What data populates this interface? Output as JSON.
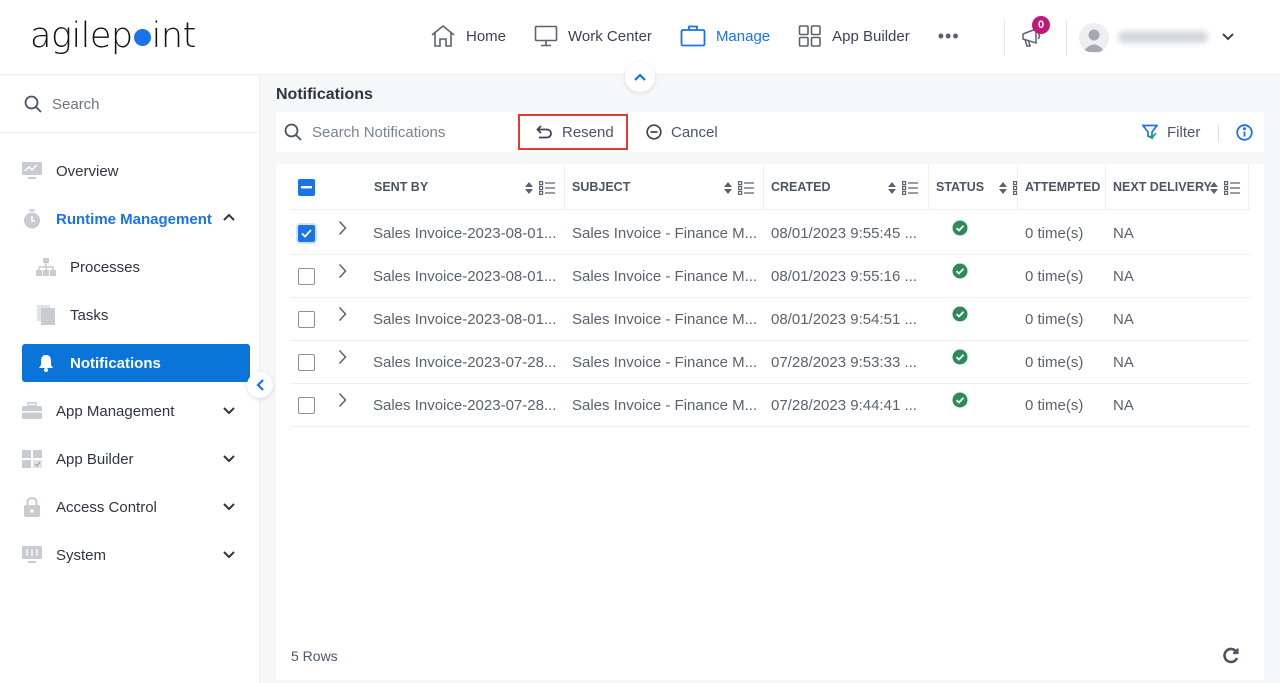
{
  "brand": {
    "logo_left": "agilep",
    "logo_right": "int",
    "accent": "#1a73e8"
  },
  "topnav": {
    "items": [
      {
        "label": "Home",
        "icon": "home-icon",
        "active": false
      },
      {
        "label": "Work Center",
        "icon": "monitor-icon",
        "active": false
      },
      {
        "label": "Manage",
        "icon": "briefcase-icon",
        "active": true
      },
      {
        "label": "App Builder",
        "icon": "grid-icon",
        "active": false
      }
    ],
    "more_label": "•••",
    "notification_count": "0"
  },
  "sidebar": {
    "search_placeholder": "Search",
    "items": [
      {
        "label": "Overview",
        "icon": "chart-monitor-icon"
      },
      {
        "label": "Runtime Management",
        "icon": "stopwatch-icon",
        "expanded": true
      },
      {
        "label": "Processes",
        "icon": "hierarchy-icon"
      },
      {
        "label": "Tasks",
        "icon": "tasks-icon"
      },
      {
        "label": "Notifications",
        "icon": "bell-icon",
        "active": true
      },
      {
        "label": "App Management",
        "icon": "toolbox-icon"
      },
      {
        "label": "App Builder",
        "icon": "app-builder-icon"
      },
      {
        "label": "Access Control",
        "icon": "lock-icon"
      },
      {
        "label": "System",
        "icon": "system-icon"
      }
    ]
  },
  "main": {
    "title": "Notifications",
    "toolbar": {
      "search_placeholder": "Search Notifications",
      "resend_label": "Resend",
      "cancel_label": "Cancel",
      "filter_label": "Filter"
    },
    "columns": [
      "SENT BY",
      "SUBJECT",
      "CREATED",
      "STATUS",
      "ATTEMPTED",
      "NEXT DELIVERY"
    ],
    "rows": [
      {
        "checked": true,
        "sent_by": "Sales Invoice-2023-08-01...",
        "subject": "Sales Invoice - Finance M...",
        "created": "08/01/2023 9:55:45 ...",
        "status": "success",
        "attempted": "0 time(s)",
        "next_delivery": "NA"
      },
      {
        "checked": false,
        "sent_by": "Sales Invoice-2023-08-01...",
        "subject": "Sales Invoice - Finance M...",
        "created": "08/01/2023 9:55:16 ...",
        "status": "success",
        "attempted": "0 time(s)",
        "next_delivery": "NA"
      },
      {
        "checked": false,
        "sent_by": "Sales Invoice-2023-08-01...",
        "subject": "Sales Invoice - Finance M...",
        "created": "08/01/2023 9:54:51 ...",
        "status": "success",
        "attempted": "0 time(s)",
        "next_delivery": "NA"
      },
      {
        "checked": false,
        "sent_by": "Sales Invoice-2023-07-28...",
        "subject": "Sales Invoice - Finance M...",
        "created": "07/28/2023 9:53:33 ...",
        "status": "success",
        "attempted": "0 time(s)",
        "next_delivery": "NA"
      },
      {
        "checked": false,
        "sent_by": "Sales Invoice-2023-07-28...",
        "subject": "Sales Invoice - Finance M...",
        "created": "07/28/2023 9:44:41 ...",
        "status": "success",
        "attempted": "0 time(s)",
        "next_delivery": "NA"
      }
    ],
    "row_count": "5 Rows",
    "status_color": "#2e8b57"
  }
}
